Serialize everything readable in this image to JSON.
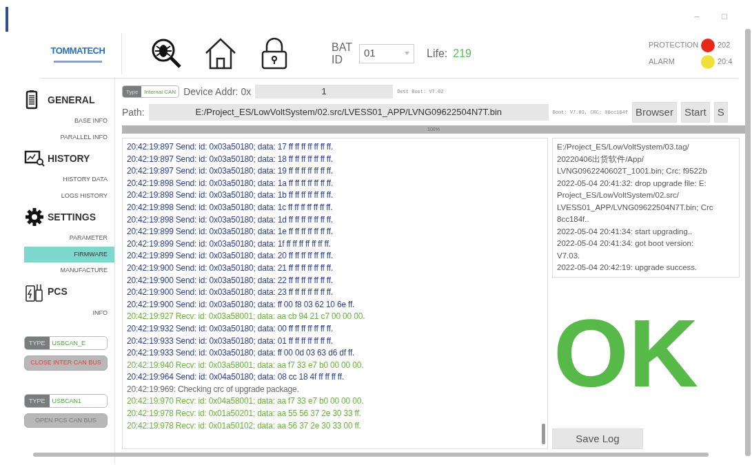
{
  "window": {
    "controls": [
      "–",
      "□"
    ]
  },
  "header": {
    "logo": "TOMMATECH",
    "tools": [
      {
        "kind": "bug-search"
      },
      {
        "kind": "home"
      },
      {
        "kind": "lock"
      }
    ],
    "bat_id_label": "BAT ID",
    "bat_id": "01",
    "life_label": "Life:",
    "life": "219",
    "indicators": [
      {
        "label": "PROTECTION",
        "color": "#e8271c",
        "text": "202"
      },
      {
        "label": "ALARM",
        "color": "#f0e03a",
        "text": "20:4"
      }
    ]
  },
  "sidebar": {
    "sections": [
      {
        "kind": "battery",
        "title": "GENERAL",
        "items": [
          {
            "label": "BASE INFO",
            "selected": false
          },
          {
            "label": "PARALLEL INFO",
            "selected": false
          }
        ]
      },
      {
        "kind": "history",
        "title": "HISTORY",
        "items": [
          {
            "label": "HISTORY DATA",
            "selected": false
          },
          {
            "label": "LOGS HISTORY",
            "selected": false
          }
        ]
      },
      {
        "kind": "gear",
        "title": "SETTINGS",
        "items": [
          {
            "label": "PARAMETER",
            "selected": false
          },
          {
            "label": "FIRMWARE",
            "selected": true
          },
          {
            "label": "MANUFACTURE",
            "selected": false
          }
        ]
      },
      {
        "kind": "pcs",
        "title": "PCS",
        "items": [
          {
            "label": "INFO",
            "selected": false
          }
        ]
      }
    ],
    "buses": [
      {
        "type_label": "TYPE",
        "value": "USBCAN_E",
        "button": "CLOSE INTER CAN BUS",
        "connected": true
      },
      {
        "type_label": "TYPE",
        "value": "USBCAN1",
        "button": "OPEN PCS CAN BUS",
        "connected": false
      }
    ]
  },
  "firmware": {
    "type_label": "Type",
    "type_value": "Internal CAN",
    "addr_label": "Device Addr: 0x",
    "addr": "1",
    "dest_boot": "Dest Boot: V7.02",
    "path_label": "Path:",
    "path": "E:/Project_ES/LowVoltSystem/02.src/LVESS01_APP/LVNG09622504N7T.bin",
    "boot_info": "Boot: V7.03, CRC: 08cc184f",
    "buttons": [
      "Browser",
      "Start",
      "S"
    ],
    "progress": {
      "level": 1,
      "text": "100%"
    },
    "log": [
      {
        "kind": "send",
        "text": "20:42:19:897 Send: id: 0x03a50180; data: 17 ff ff ff ff ff ff ff."
      },
      {
        "kind": "send",
        "text": "20:42:19:897 Send: id: 0x03a50180; data: 18 ff ff ff ff ff ff ff."
      },
      {
        "kind": "send",
        "text": "20:42:19:897 Send: id: 0x03a50180; data: 19 ff ff ff ff ff ff ff."
      },
      {
        "kind": "send",
        "text": "20:42:19:898 Send: id: 0x03a50180; data: 1a ff ff ff ff ff ff ff."
      },
      {
        "kind": "send",
        "text": "20:42:19:898 Send: id: 0x03a50180; data: 1b ff ff ff ff ff ff ff."
      },
      {
        "kind": "send",
        "text": "20:42:19:898 Send: id: 0x03a50180; data: 1c ff ff ff ff ff ff ff."
      },
      {
        "kind": "send",
        "text": "20:42:19:898 Send: id: 0x03a50180; data: 1d ff ff ff ff ff ff ff."
      },
      {
        "kind": "send",
        "text": "20:42:19:899 Send: id: 0x03a50180; data: 1e ff ff ff ff ff ff ff."
      },
      {
        "kind": "send",
        "text": "20:42:19:899 Send: id: 0x03a50180; data: 1f ff ff ff ff ff ff ff."
      },
      {
        "kind": "send",
        "text": "20:42:19:899 Send: id: 0x03a50180; data: 20 ff ff ff ff ff ff ff."
      },
      {
        "kind": "send",
        "text": "20:42:19:900 Send: id: 0x03a50180; data: 21 ff ff ff ff ff ff ff."
      },
      {
        "kind": "send",
        "text": "20:42:19:900 Send: id: 0x03a50180; data: 22 ff ff ff ff ff ff ff."
      },
      {
        "kind": "send",
        "text": "20:42:19:900 Send: id: 0x03a50180; data: 23 ff ff ff ff ff ff ff."
      },
      {
        "kind": "send",
        "text": "20:42:19:900 Send: id: 0x03a50180; data: ff 00 f8 03 62 10 6e ff."
      },
      {
        "kind": "recv",
        "text": "20:42:19:927 Recv: id: 0x03a58001; data: aa cb 94 21 c7 00 00 00."
      },
      {
        "kind": "send",
        "text": "20:42:19:932 Send: id: 0x03a50180; data: 00 ff ff ff ff ff ff ff."
      },
      {
        "kind": "send",
        "text": "20:42:19:933 Send: id: 0x03a50180; data: 01 ff ff ff ff ff ff ff."
      },
      {
        "kind": "send",
        "text": "20:42:19:933 Send: id: 0x03a50180; data: ff 00 0d 03 63 d6 df ff."
      },
      {
        "kind": "recv",
        "text": "20:42:19:940 Recv: id: 0x03a58001; data: aa f7 33 e7 b0 00 00 00."
      },
      {
        "kind": "send",
        "text": "20:42:19:964 Send: id: 0x04a50180; data: 08 cc 18 4f ff ff ff ff."
      },
      {
        "kind": "info",
        "text": "20:42:19:969: Checking crc of upgrade package."
      },
      {
        "kind": "recv",
        "text": "20:42:19:970 Recv: id: 0x04a58001; data: aa f7 33 e7 b0 00 00 00."
      },
      {
        "kind": "recv",
        "text": "20:42:19:978 Recv: id: 0x01a50201; data: aa 55 56 37 2e 30 33 ff."
      },
      {
        "kind": "recv",
        "text": "20:42:19:978 Recv: id: 0x01a50102; data: aa 56 37 2e 30 33 00 ff."
      }
    ],
    "status_log": [
      "E:/Project_ES/LowVoltSystem/03.tag/",
      "20220406出货软件/App/",
      "LVNG0962240602T_1001.bin; Crc: f9522b",
      "2022-05-04 20:41:32: drop upgrade file: E:",
      "Project_ES/LowVoltSystem/02.src/",
      "LVESS01_APP/LVNG09622504N7T.bin; Crc",
      "8cc184f..",
      "2022-05-04 20:41:34: start upgrading..",
      "2022-05-04 20:41:34: got boot version:",
      "V7.03.",
      "2022-05-04 20:42:19: upgrade success."
    ],
    "result": "OK",
    "save_button": "Save Log"
  }
}
